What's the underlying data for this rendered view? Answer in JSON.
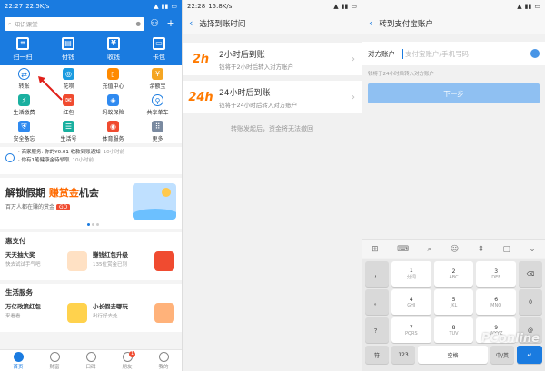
{
  "screens": {
    "home": {
      "status": {
        "time": "22:27",
        "speed": "22.5K/s"
      },
      "search": {
        "placeholder": "知识课堂"
      },
      "top_actions": [
        "扫一扫",
        "付钱",
        "收钱",
        "卡包"
      ],
      "apps": [
        "转账",
        "花呗",
        "充值中心",
        "余额宝",
        "生活缴费",
        "红包",
        "蚂蚁保险",
        "共享单车",
        "安全备忘",
        "生活号",
        "体育服务",
        "更多"
      ],
      "notice": {
        "rows": [
          {
            "text": "· 商家服务: 你的¥0.01 收款到账通知",
            "time": "10小时前"
          },
          {
            "text": "· 你有1笔健康金待领取",
            "time": "10小时前"
          }
        ]
      },
      "promo": {
        "title_a": "解锁假期",
        "title_b": "赚赏金",
        "title_c": "机会",
        "sub": "百万人都在赚的赏金",
        "go": "GO"
      },
      "sections": [
        {
          "title": "惠支付",
          "cards": [
            {
              "title": "天天抽大奖",
              "sub": "快去试试手气吧"
            },
            {
              "title": "赚钱红包升级",
              "sub": "135位赏金已到"
            }
          ]
        },
        {
          "title": "生活服务",
          "cards": [
            {
              "title": "万亿政策红包",
              "sub": "来看看"
            },
            {
              "title": "小长假去哪玩",
              "sub": "出行好去处"
            }
          ]
        }
      ],
      "tabs": [
        "首页",
        "财富",
        "口碑",
        "朋友",
        "我的"
      ],
      "tab_badge": "1"
    },
    "time_select": {
      "status": {
        "time": "22:28",
        "speed": "15.8K/s"
      },
      "title": "选择到账时间",
      "options": [
        {
          "logo": "2h",
          "main": "2小时后到账",
          "desc": "钱将于2小时后转入对方账户"
        },
        {
          "logo": "24h",
          "main": "24小时后到账",
          "desc": "钱将于24小时后转入对方账户"
        }
      ],
      "warning": "转账发起后，资金将无法撤回"
    },
    "transfer": {
      "title": "转到支付宝账户",
      "field_label": "对方账户",
      "field_placeholder": "支付宝账户/手机号码",
      "tip": "钱将于24小时后转入对方账户",
      "next": "下一步",
      "keys": [
        [
          "1",
          "2",
          "3",
          "⌫"
        ],
        [
          "4",
          "5",
          "6",
          "0"
        ],
        [
          "7",
          "8",
          "9",
          "@"
        ]
      ],
      "key_letters": [
        [
          "分词",
          "ABC",
          "DEF",
          ""
        ],
        [
          "GHI",
          "JKL",
          "MNO",
          ""
        ],
        [
          "PQRS",
          "TUV",
          "WXYZ",
          ""
        ]
      ],
      "bottom_keys": [
        "符",
        "123",
        "空格",
        "中/英",
        "↵"
      ],
      "watermark": "PConline"
    }
  }
}
